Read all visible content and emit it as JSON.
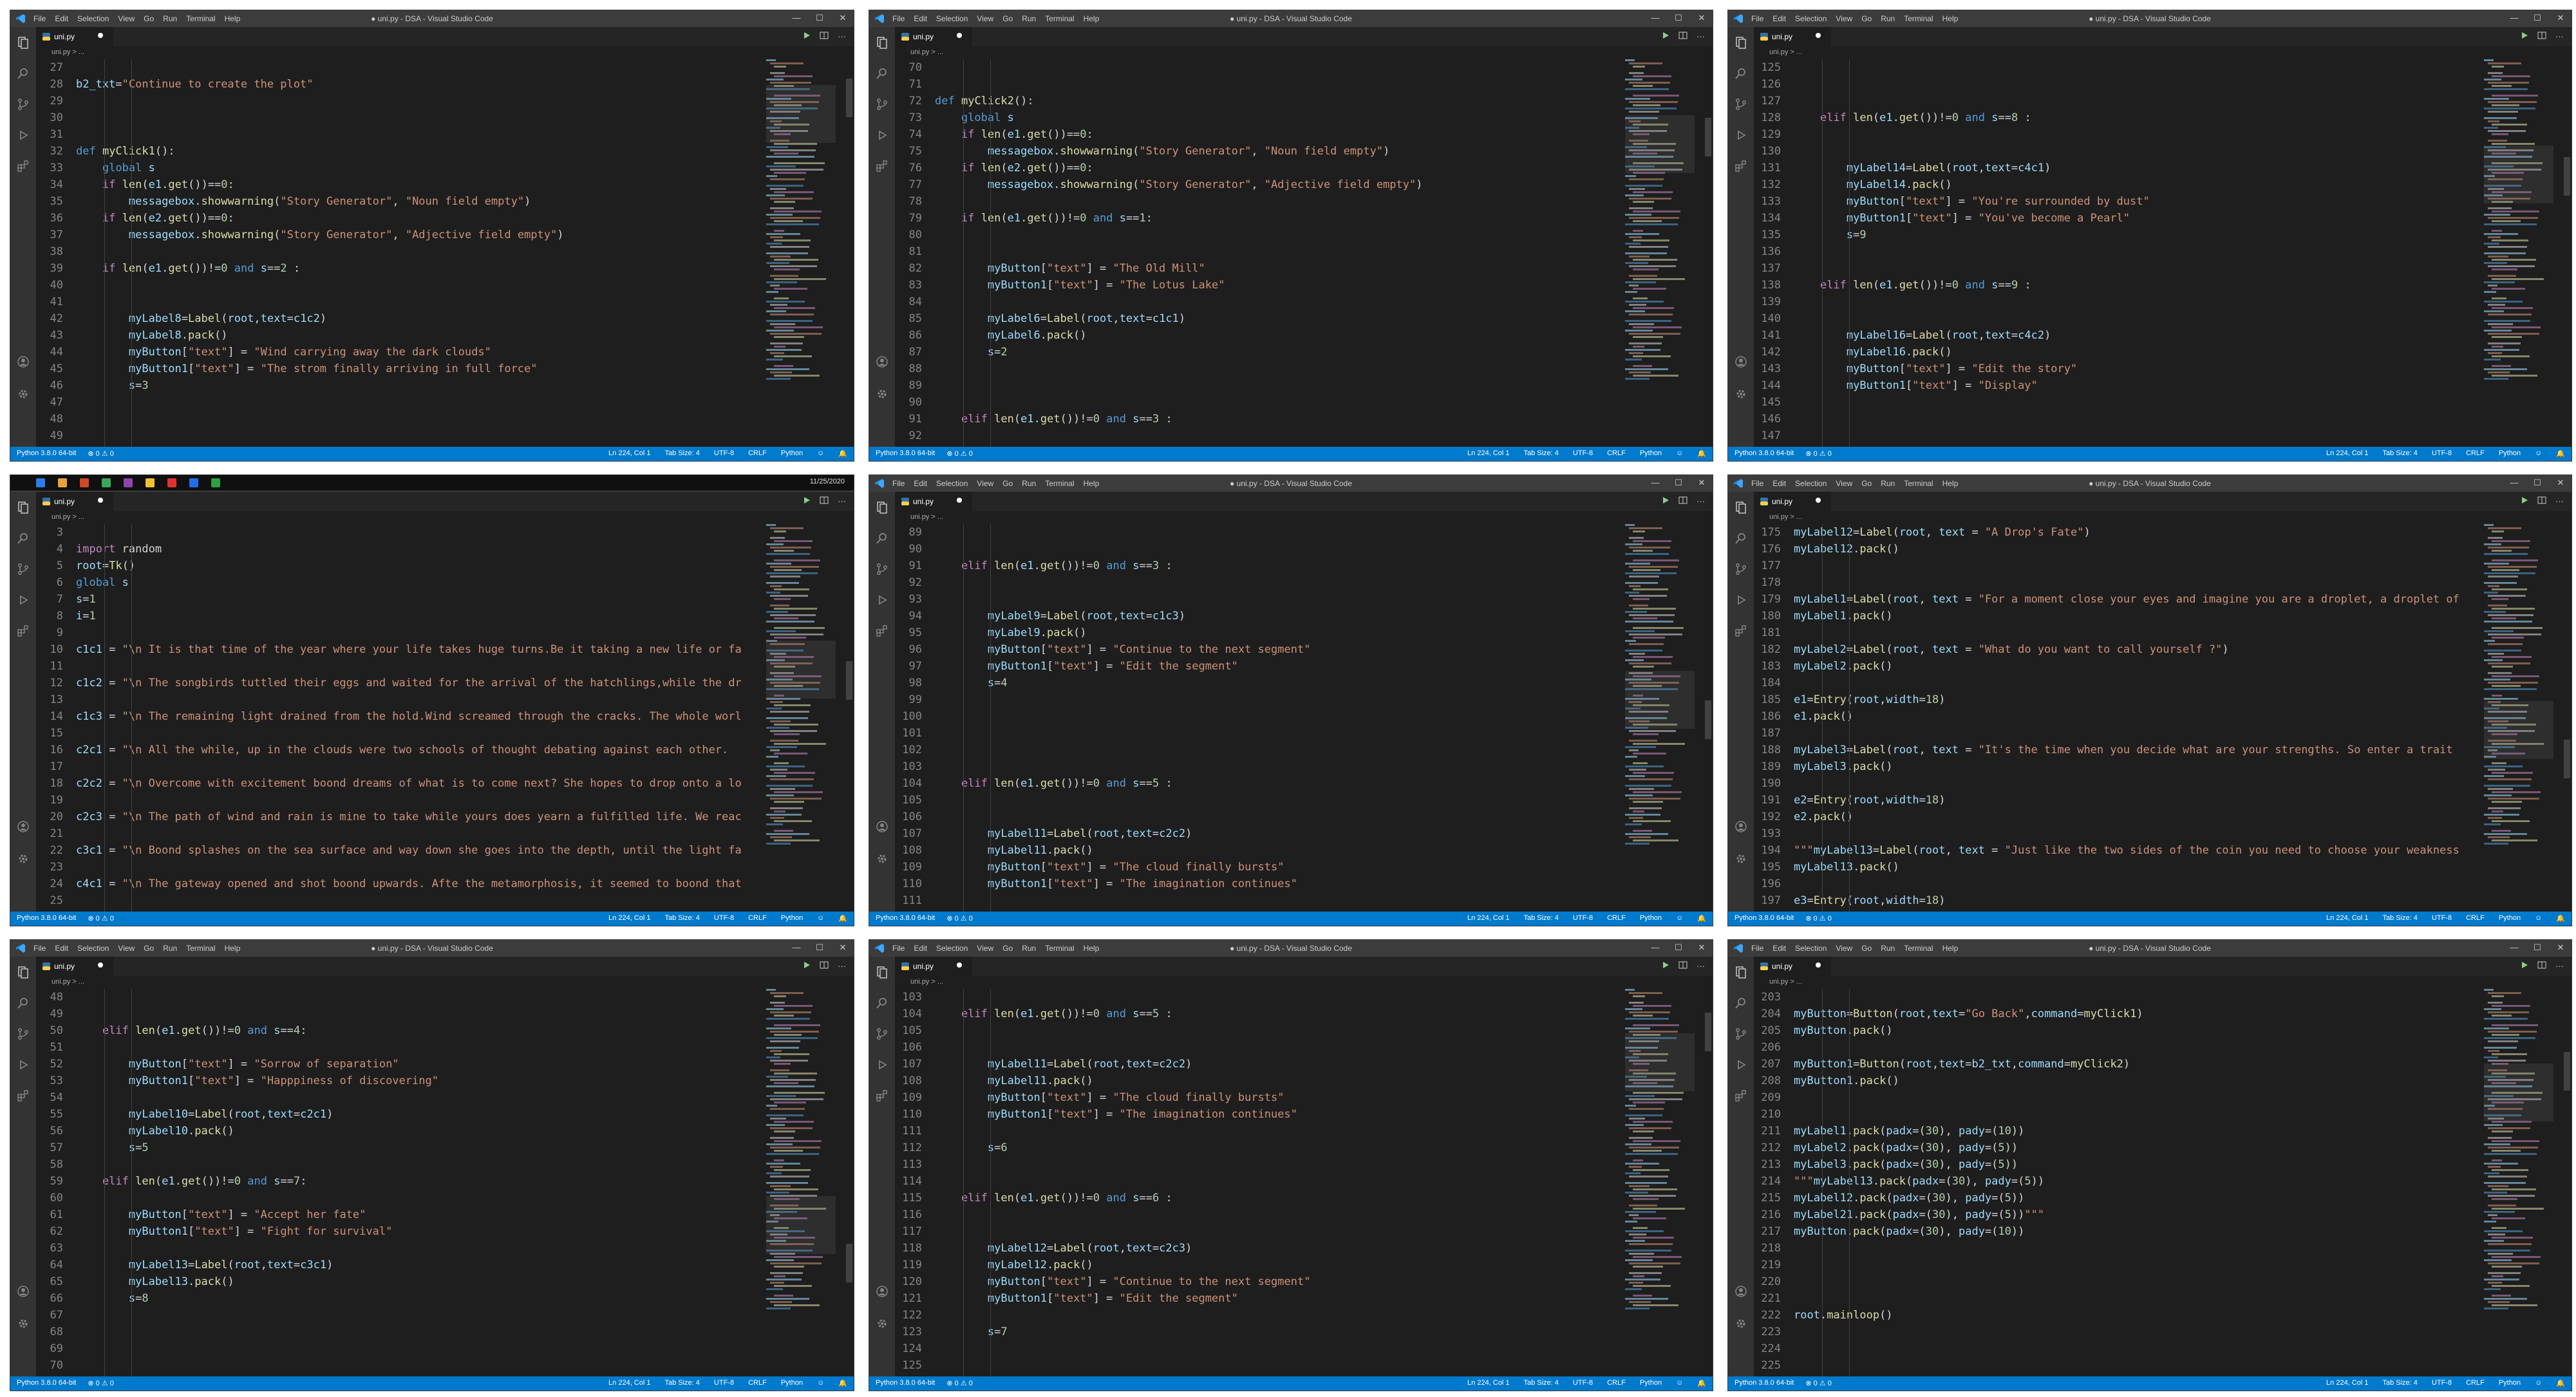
{
  "colors": {
    "keyword": "#569cd6",
    "control": "#c586c0",
    "string": "#ce9178",
    "number": "#b5cea8",
    "function": "#dcdcaa",
    "variable": "#9cdcfe",
    "plain": "#d4d4d4",
    "statusbar": "#007acc"
  },
  "menu": [
    "File",
    "Edit",
    "Selection",
    "View",
    "Go",
    "Run",
    "Terminal",
    "Help"
  ],
  "window_title": "● uni.py - DSA - Visual Studio Code",
  "tab_label": "uni.py",
  "breadcrumb": "uni.py > ...",
  "status_left": [
    "Python 3.8.0 64-bit",
    "⊗ 0 ⚠ 0"
  ],
  "status_right": [
    "Ln 224, Col 1",
    "Tab Size: 4",
    "UTF-8",
    "CRLF",
    "Python"
  ],
  "taskbar_clock": "11/25/2020",
  "panels": [
    {
      "start": 27,
      "lines": [
        "",
        "b2_txt=\"Continue to create the plot\"",
        "",
        "",
        "",
        "def myClick1():",
        "    global s",
        "    if len(e1.get())==0:",
        "        messagebox.showwarning(\"Story Generator\", \"Noun field empty\")",
        "    if len(e2.get())==0:",
        "        messagebox.showwarning(\"Story Generator\", \"Adjective field empty\")",
        "",
        "    if len(e1.get())!=0 and s==2 :",
        "",
        "",
        "        myLabel8=Label(root,text=c1c2)",
        "        myLabel8.pack()",
        "        myButton[\"text\"] = \"Wind carrying away the dark clouds\"",
        "        myButton1[\"text\"] = \"The strom finally arriving in full force\"",
        "        s=3",
        "",
        "",
        ""
      ]
    },
    {
      "start": 70,
      "lines": [
        "",
        "",
        "def myClick2():",
        "    global s",
        "    if len(e1.get())==0:",
        "        messagebox.showwarning(\"Story Generator\", \"Noun field empty\")",
        "    if len(e2.get())==0:",
        "        messagebox.showwarning(\"Story Generator\", \"Adjective field empty\")",
        "",
        "    if len(e1.get())!=0 and s==1:",
        "",
        "",
        "        myButton[\"text\"] = \"The Old Mill\"",
        "        myButton1[\"text\"] = \"The Lotus Lake\"",
        "",
        "        myLabel6=Label(root,text=c1c1)",
        "        myLabel6.pack()",
        "        s=2",
        "",
        "",
        "",
        "    elif len(e1.get())!=0 and s==3 :",
        ""
      ]
    },
    {
      "start": 125,
      "lines": [
        "",
        "",
        "",
        "    elif len(e1.get())!=0 and s==8 :",
        "",
        "",
        "        myLabel14=Label(root,text=c4c1)",
        "        myLabel14.pack()",
        "        myButton[\"text\"] = \"You're surrounded by dust\"",
        "        myButton1[\"text\"] = \"You've become a Pearl\"",
        "        s=9",
        "",
        "",
        "    elif len(e1.get())!=0 and s==9 :",
        "",
        "",
        "        myLabel16=Label(root,text=c4c2)",
        "        myLabel16.pack()",
        "        myButton[\"text\"] = \"Edit the story\"",
        "        myButton1[\"text\"] = \"Display\"",
        "",
        "",
        ""
      ]
    },
    {
      "start": 3,
      "lines": [
        "",
        "import random",
        "root=Tk()",
        "global s",
        "s=1",
        "i=1",
        "",
        "c1c1 = \"\\n It is that time of the year where your life takes huge turns.Be it taking a new life or fa",
        "",
        "c1c2 = \"\\n The songbirds tuttled their eggs and waited for the arrival of the hatchlings,while the dr",
        "",
        "c1c3 = \"\\n The remaining light drained from the hold.Wind screamed through the cracks. The whole worl",
        "",
        "c2c1 = \"\\n All the while, up in the clouds were two schools of thought debating against each other.",
        "",
        "c2c2 = \"\\n Overcome with excitement boond dreams of what is to come next? She hopes to drop onto a lo",
        "",
        "c2c3 = \"\\n The path of wind and rain is mine to take while yours does yearn a fulfilled life. We reac",
        "",
        "c3c1 = \"\\n Boond splashes on the sea surface and way down she goes into the depth, until the light fa",
        "",
        "c4c1 = \"\\n The gateway opened and shot boond upwards. Afte the metamorphosis, it seemed to boond that",
        "",
        "c4c2 = \"\\n She was a pearl now. She bid adieue to her oyster and thanked it. What once was her prison"
      ]
    },
    {
      "start": 89,
      "lines": [
        "",
        "",
        "    elif len(e1.get())!=0 and s==3 :",
        "",
        "",
        "        myLabel9=Label(root,text=c1c3)",
        "        myLabel9.pack()",
        "        myButton[\"text\"] = \"Continue to the next segment\"",
        "        myButton1[\"text\"] = \"Edit the segment\"",
        "        s=4",
        "",
        "",
        "",
        "",
        "",
        "    elif len(e1.get())!=0 and s==5 :",
        "",
        "",
        "        myLabel11=Label(root,text=c2c2)",
        "        myLabel11.pack()",
        "        myButton[\"text\"] = \"The cloud finally bursts\"",
        "        myButton1[\"text\"] = \"The imagination continues\"",
        ""
      ]
    },
    {
      "start": 175,
      "lines": [
        "myLabel12=Label(root, text = \"A Drop's Fate\")",
        "myLabel12.pack()",
        "",
        "",
        "myLabel1=Label(root, text = \"For a moment close your eyes and imagine you are a droplet, a droplet of",
        "myLabel1.pack()",
        "",
        "myLabel2=Label(root, text = \"What do you want to call yourself ?\")",
        "myLabel2.pack()",
        "",
        "e1=Entry(root,width=18)",
        "e1.pack()",
        "",
        "myLabel3=Label(root, text = \"It's the time when you decide what are your strengths. So enter a trait",
        "myLabel3.pack()",
        "",
        "e2=Entry(root,width=18)",
        "e2.pack()",
        "",
        "\"\"\"myLabel13=Label(root, text = \"Just like the two sides of the coin you need to choose your weakness",
        "myLabel13.pack()",
        "",
        "e3=Entry(root,width=18)"
      ]
    },
    {
      "start": 48,
      "lines": [
        "",
        "",
        "    elif len(e1.get())!=0 and s==4:",
        "",
        "        myButton[\"text\"] = \"Sorrow of separation\"",
        "        myButton1[\"text\"] = \"Happpiness of discovering\"",
        "",
        "        myLabel10=Label(root,text=c2c1)",
        "        myLabel10.pack()",
        "        s=5",
        "",
        "    elif len(e1.get())!=0 and s==7:",
        "",
        "        myButton[\"text\"] = \"Accept her fate\"",
        "        myButton1[\"text\"] = \"Fight for survival\"",
        "",
        "        myLabel13=Label(root,text=c3c1)",
        "        myLabel13.pack()",
        "        s=8",
        "",
        "",
        "",
        ""
      ]
    },
    {
      "start": 103,
      "lines": [
        "",
        "    elif len(e1.get())!=0 and s==5 :",
        "",
        "",
        "        myLabel11=Label(root,text=c2c2)",
        "        myLabel11.pack()",
        "        myButton[\"text\"] = \"The cloud finally bursts\"",
        "        myButton1[\"text\"] = \"The imagination continues\"",
        "",
        "        s=6",
        "",
        "",
        "    elif len(e1.get())!=0 and s==6 :",
        "",
        "",
        "        myLabel12=Label(root,text=c2c3)",
        "        myLabel12.pack()",
        "        myButton[\"text\"] = \"Continue to the next segment\"",
        "        myButton1[\"text\"] = \"Edit the segment\"",
        "",
        "        s=7",
        "",
        ""
      ]
    },
    {
      "start": 203,
      "lines": [
        "",
        "myButton=Button(root,text=\"Go Back\",command=myClick1)",
        "myButton.pack()",
        "",
        "myButton1=Button(root,text=b2_txt,command=myClick2)",
        "myButton1.pack()",
        "",
        "",
        "myLabel1.pack(padx=(30), pady=(10))",
        "myLabel2.pack(padx=(30), pady=(5))",
        "myLabel3.pack(padx=(30), pady=(5))",
        "\"\"\"myLabel13.pack(padx=(30), pady=(5))",
        "myLabel12.pack(padx=(30), pady=(5))",
        "myLabel21.pack(padx=(30), pady=(5))\"\"\"",
        "myButton.pack(padx=(30), pady=(10))",
        "",
        "",
        "",
        "",
        "root.mainloop()",
        "",
        "",
        ""
      ]
    }
  ]
}
